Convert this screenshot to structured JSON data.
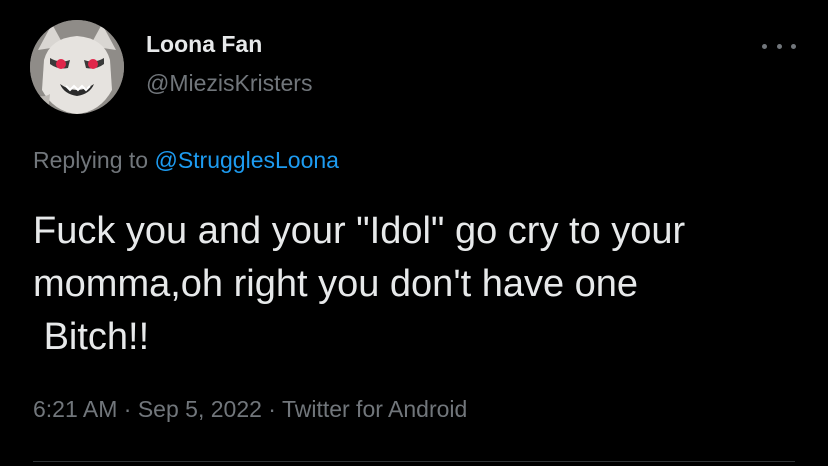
{
  "tweet": {
    "display_name": "Loona Fan",
    "handle": "@MiezisKristers",
    "replying_prefix": "Replying to ",
    "replying_to": "@StrugglesLoona",
    "text": "Fuck you and your \"Idol\" go cry to your\nmomma,oh right you don't have one\n Bitch!!",
    "time": "6:21 AM",
    "separator": " · ",
    "date": "Sep 5, 2022",
    "source": "Twitter for Android"
  },
  "icons": {
    "more": "more-options-icon",
    "avatar": "avatar"
  },
  "colors": {
    "background": "#000000",
    "primary_text": "#e7e9ea",
    "secondary_text": "#71767b",
    "accent": "#1d9bf0",
    "divider": "#2f3336"
  }
}
